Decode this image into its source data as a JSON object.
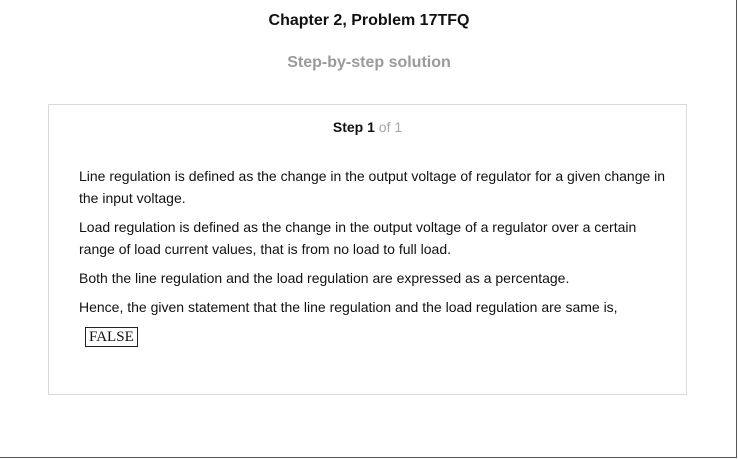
{
  "header": {
    "title": "Chapter 2, Problem 17TFQ",
    "subtitle": "Step-by-step solution"
  },
  "step": {
    "label": "Step",
    "number": "1",
    "of_text": "of 1"
  },
  "solution": {
    "paragraphs": [
      "Line regulation is defined as the change in the output voltage of regulator for a given change in the input voltage.",
      "Load regulation is defined as the change in the output voltage of a regulator over a certain range of load current values, that is from no load to full load.",
      "Both the line regulation and the load regulation are expressed as a percentage.",
      "Hence, the given statement that the line regulation and the load regulation are same is,"
    ],
    "answer": "FALSE"
  }
}
